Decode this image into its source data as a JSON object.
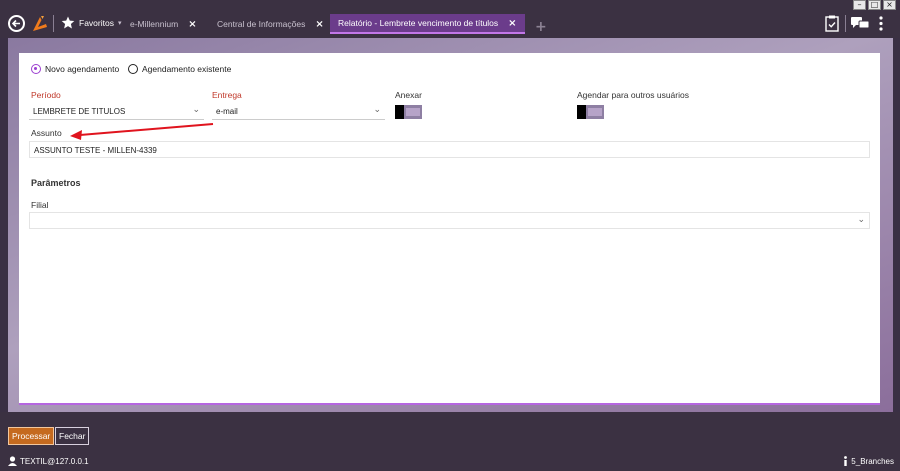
{
  "window_controls": {
    "minimize": "–",
    "maximize": "□",
    "close": "×"
  },
  "nav": {
    "favorites_label": "Favoritos",
    "favorites_caret": "▾"
  },
  "tabs": [
    {
      "label": "e-Millennium",
      "close": "×"
    },
    {
      "label": "Central de Informações",
      "close": "×"
    },
    {
      "label": "Relatório - Lembrete vencimento de  títulos",
      "close": "×",
      "active": true
    }
  ],
  "add_tab": "+",
  "form": {
    "radio_new": "Novo agendamento",
    "radio_existing": "Agendamento existente",
    "radio_selected": "new",
    "periodo_label": "Período",
    "periodo_value": "LEMBRETE DE TITULOS",
    "entrega_label": "Entrega",
    "entrega_value": "e-mail",
    "anexar_label": "Anexar",
    "agendar_label": "Agendar para outros usuários",
    "assunto_label": "Assunto",
    "assunto_value": "ASSUNTO TESTE - MILLEN-4339",
    "parametros_title": "Parâmetros",
    "filial_label": "Filial",
    "filial_value": ""
  },
  "footer": {
    "process_label": "Processar",
    "close_label": "Fechar",
    "user": "TEXTIL@127.0.0.1",
    "branches": "5_Branches"
  },
  "colors": {
    "accent": "#9c3fd0",
    "active_tab": "#6b3c8b",
    "required_label": "#c0392b",
    "primary_button": "#c56a1f",
    "annotation_arrow": "#e0141e"
  }
}
